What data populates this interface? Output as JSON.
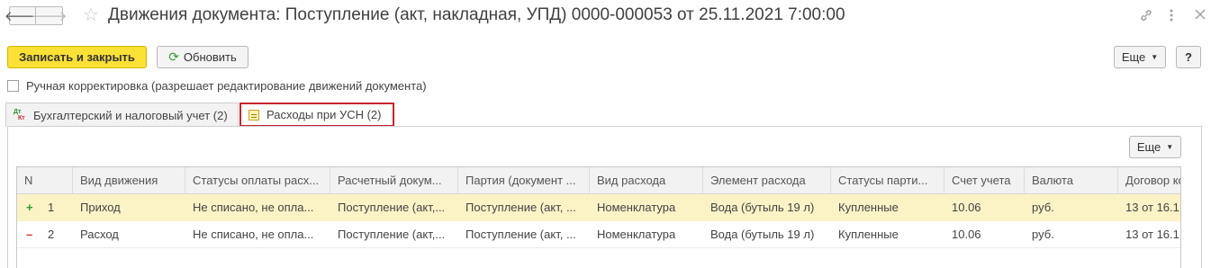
{
  "window": {
    "title": "Движения документа: Поступление (акт, накладная, УПД) 0000-000053 от 25.11.2021 7:00:00",
    "back_icon": "🡐",
    "forward_icon": "🡒"
  },
  "toolbar": {
    "save_close_label": "Записать и закрыть",
    "refresh_label": "Обновить",
    "more_label": "Еще",
    "help_label": "?"
  },
  "manual_adjust": {
    "label": "Ручная корректировка (разрешает редактирование движений документа)",
    "checked": false
  },
  "tabs": [
    {
      "label": "Бухгалтерский и налоговый учет (2)",
      "icon_top": "Дт",
      "icon_bottom": "Кт"
    },
    {
      "label": "Расходы при УСН (2)",
      "active": true
    }
  ],
  "grid": {
    "more_label": "Еще",
    "columns": [
      "N",
      "Вид движения",
      "Статусы оплаты расх...",
      "Расчетный докум...",
      "Партия (документ ...",
      "Вид расхода",
      "Элемент расхода",
      "Статусы парти...",
      "Счет учета",
      "Валюта",
      "Договор ко"
    ],
    "rows": [
      {
        "sign": "+",
        "n": "1",
        "kind": "Приход",
        "pay_status": "Не списано, не опла...",
        "settle_doc": "Поступление (акт,...",
        "batch": "Поступление (акт, ...",
        "expense_type": "Номенклатура",
        "expense_item": "Вода (бутыль 19 л)",
        "batch_status": "Купленные",
        "account": "10.06",
        "currency": "руб.",
        "contract": "13 от 16.1"
      },
      {
        "sign": "–",
        "n": "2",
        "kind": "Расход",
        "pay_status": "Не списано, не опла...",
        "settle_doc": "Поступление (акт,...",
        "batch": "Поступление (акт, ...",
        "expense_type": "Номенклатура",
        "expense_item": "Вода (бутыль 19 л)",
        "batch_status": "Купленные",
        "account": "10.06",
        "currency": "руб.",
        "contract": "13 от 16.1"
      }
    ]
  }
}
